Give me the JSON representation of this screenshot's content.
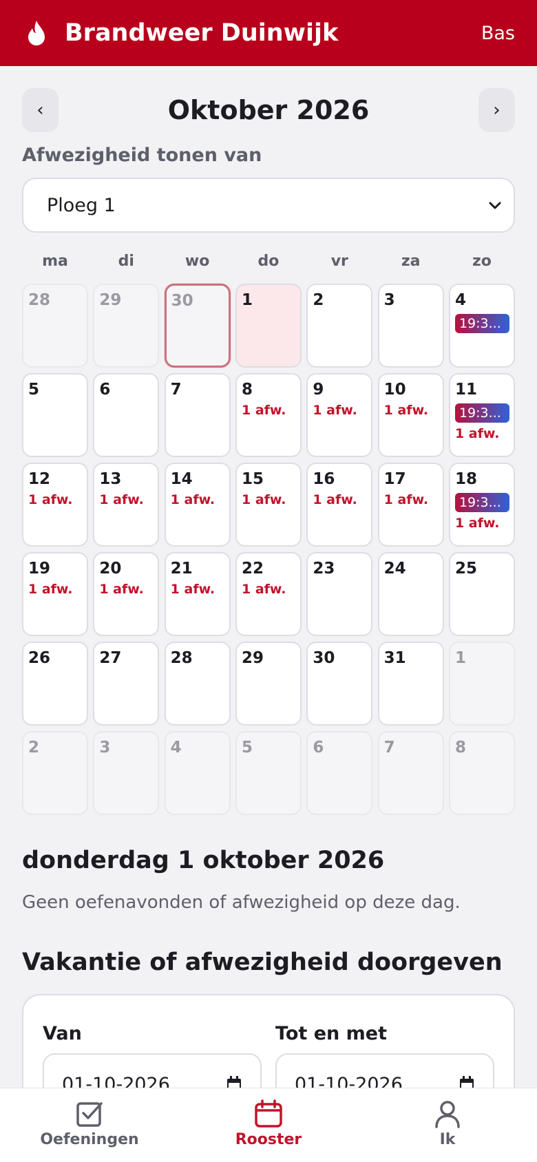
{
  "header": {
    "title": "Brandweer Duinwijk",
    "user": "Bas",
    "brand_color": "#b8001c",
    "logo_icon": "flame-icon"
  },
  "calendar": {
    "month_title": "Oktober 2026",
    "prev_label": "‹",
    "next_label": "›",
    "absence_label": "Afwezigheid tonen van",
    "absence_selected": "Ploeg 1",
    "weekdays": [
      "ma",
      "di",
      "wo",
      "do",
      "vr",
      "za",
      "zo"
    ],
    "days": [
      {
        "n": "28",
        "other": true
      },
      {
        "n": "29",
        "other": true
      },
      {
        "n": "30",
        "other": true,
        "today": true
      },
      {
        "n": "1",
        "selected": true
      },
      {
        "n": "2"
      },
      {
        "n": "3"
      },
      {
        "n": "4",
        "event": "19:3..."
      },
      {
        "n": "5"
      },
      {
        "n": "6"
      },
      {
        "n": "7"
      },
      {
        "n": "8",
        "afw": "1 afw."
      },
      {
        "n": "9",
        "afw": "1 afw."
      },
      {
        "n": "10",
        "afw": "1 afw."
      },
      {
        "n": "11",
        "event": "19:3...",
        "afw": "1 afw."
      },
      {
        "n": "12",
        "afw": "1 afw."
      },
      {
        "n": "13",
        "afw": "1 afw."
      },
      {
        "n": "14",
        "afw": "1 afw."
      },
      {
        "n": "15",
        "afw": "1 afw."
      },
      {
        "n": "16",
        "afw": "1 afw."
      },
      {
        "n": "17",
        "afw": "1 afw."
      },
      {
        "n": "18",
        "event": "19:3...",
        "afw": "1 afw."
      },
      {
        "n": "19",
        "afw": "1 afw."
      },
      {
        "n": "20",
        "afw": "1 afw."
      },
      {
        "n": "21",
        "afw": "1 afw."
      },
      {
        "n": "22",
        "afw": "1 afw."
      },
      {
        "n": "23"
      },
      {
        "n": "24"
      },
      {
        "n": "25"
      },
      {
        "n": "26"
      },
      {
        "n": "27"
      },
      {
        "n": "28"
      },
      {
        "n": "29"
      },
      {
        "n": "30"
      },
      {
        "n": "31"
      },
      {
        "n": "1",
        "other": true
      },
      {
        "n": "2",
        "other": true
      },
      {
        "n": "3",
        "other": true
      },
      {
        "n": "4",
        "other": true
      },
      {
        "n": "5",
        "other": true
      },
      {
        "n": "6",
        "other": true
      },
      {
        "n": "7",
        "other": true
      },
      {
        "n": "8",
        "other": true
      }
    ]
  },
  "day_detail": {
    "title": "donderdag 1 oktober 2026",
    "text": "Geen oefenavonden of afwezigheid op deze dag."
  },
  "vacation": {
    "title": "Vakantie of afwezigheid doorgeven",
    "from_label": "Van",
    "from_value": "01-10-2026",
    "to_label": "Tot en met",
    "to_value": "01-10-2026"
  },
  "tabs": [
    {
      "label": "Oefeningen",
      "icon": "checkbox-icon",
      "active": false
    },
    {
      "label": "Rooster",
      "icon": "calendar-icon",
      "active": true
    },
    {
      "label": "Ik",
      "icon": "user-icon",
      "active": false
    }
  ]
}
